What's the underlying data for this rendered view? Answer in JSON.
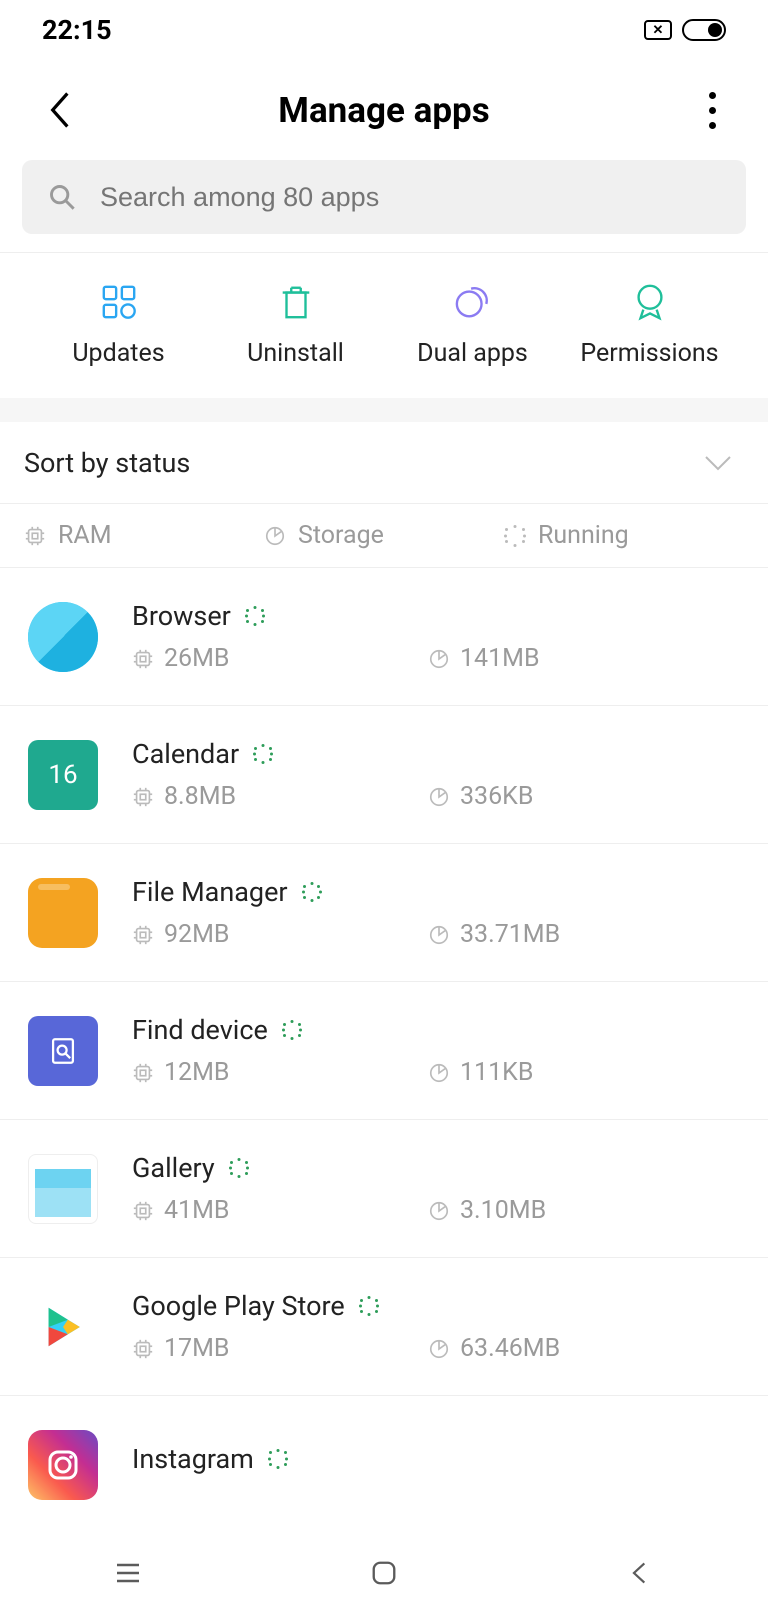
{
  "status": {
    "time": "22:15"
  },
  "header": {
    "title": "Manage apps"
  },
  "search": {
    "placeholder": "Search among 80 apps"
  },
  "actions": {
    "updates": "Updates",
    "uninstall": "Uninstall",
    "dual": "Dual apps",
    "permissions": "Permissions"
  },
  "sort": {
    "label": "Sort by status"
  },
  "legend": {
    "ram": "RAM",
    "storage": "Storage",
    "running": "Running"
  },
  "apps": [
    {
      "name": "Browser",
      "ram": "26MB",
      "storage": "141MB",
      "running": true,
      "icon": "browser",
      "calText": ""
    },
    {
      "name": "Calendar",
      "ram": "8.8MB",
      "storage": "336KB",
      "running": true,
      "icon": "calendar",
      "calText": "16"
    },
    {
      "name": "File Manager",
      "ram": "92MB",
      "storage": "33.71MB",
      "running": true,
      "icon": "file",
      "calText": ""
    },
    {
      "name": "Find device",
      "ram": "12MB",
      "storage": "111KB",
      "running": true,
      "icon": "find",
      "calText": ""
    },
    {
      "name": "Gallery",
      "ram": "41MB",
      "storage": "3.10MB",
      "running": true,
      "icon": "gallery",
      "calText": ""
    },
    {
      "name": "Google Play Store",
      "ram": "17MB",
      "storage": "63.46MB",
      "running": true,
      "icon": "play",
      "calText": ""
    },
    {
      "name": "Instagram",
      "ram": "",
      "storage": "",
      "running": true,
      "icon": "insta",
      "calText": ""
    }
  ]
}
